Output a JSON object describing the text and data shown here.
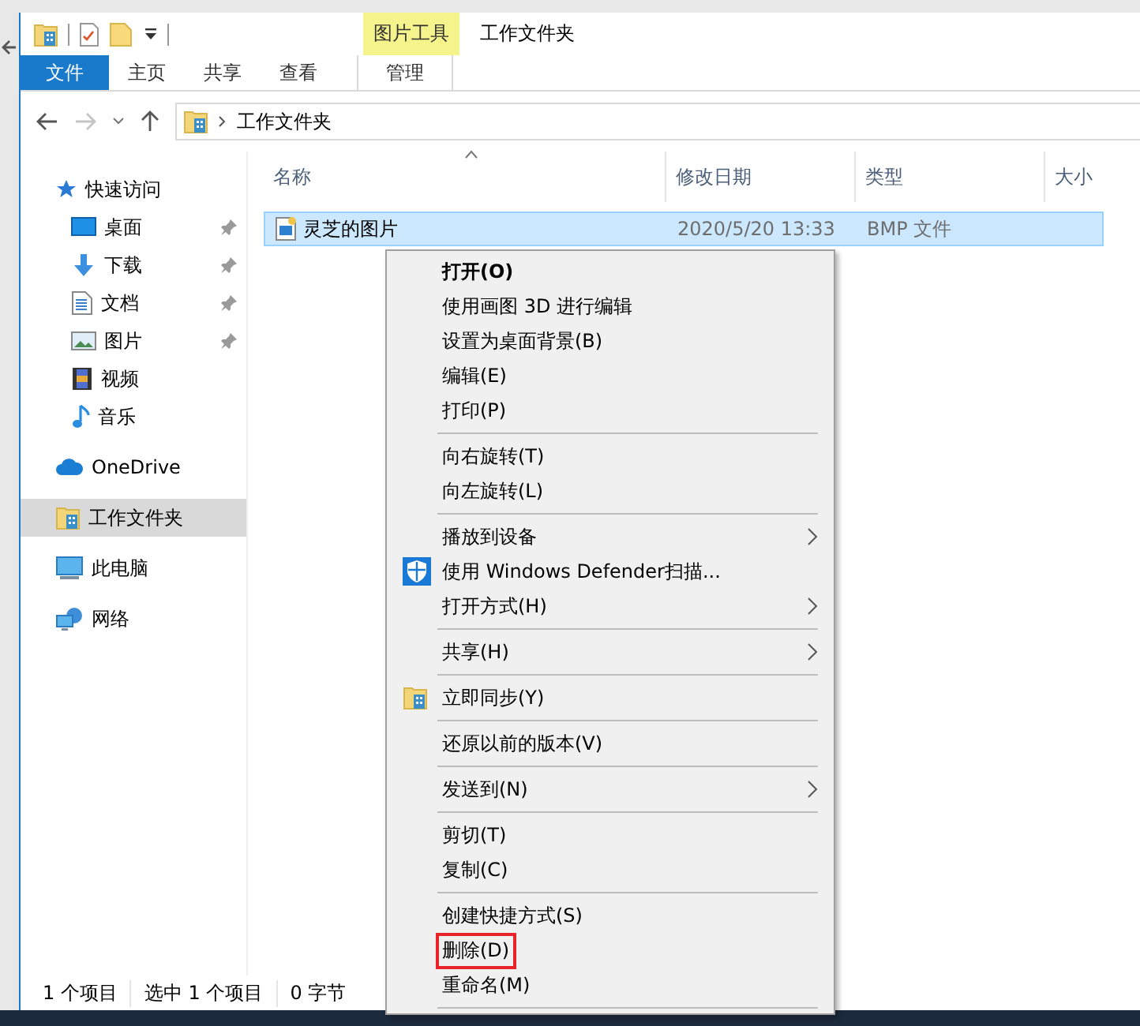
{
  "window": {
    "title": "工作文件夹",
    "contextual_tab": "图片工具"
  },
  "ribbon_tabs": [
    {
      "label": "文件",
      "kind": "file",
      "selected": false
    },
    {
      "label": "主页",
      "kind": "normal",
      "selected": false
    },
    {
      "label": "共享",
      "kind": "normal",
      "selected": false
    },
    {
      "label": "查看",
      "kind": "normal",
      "selected": false
    },
    {
      "label": "管理",
      "kind": "contextual",
      "selected": false
    }
  ],
  "navigation": {
    "back_disabled": false,
    "forward_disabled": true
  },
  "address": {
    "location": "工作文件夹"
  },
  "navigation_pane": [
    {
      "label": "快速访问",
      "selected": false,
      "children": [
        {
          "label": "桌面",
          "pinned": true,
          "selected": false
        },
        {
          "label": "下载",
          "pinned": true,
          "selected": false
        },
        {
          "label": "文档",
          "pinned": true,
          "selected": false
        },
        {
          "label": "图片",
          "pinned": true,
          "selected": false
        },
        {
          "label": "视频",
          "pinned": false,
          "selected": false
        },
        {
          "label": "音乐",
          "pinned": false,
          "selected": false
        }
      ]
    },
    {
      "label": "OneDrive",
      "selected": false
    },
    {
      "label": "工作文件夹",
      "selected": true
    },
    {
      "label": "此电脑",
      "selected": false
    },
    {
      "label": "网络",
      "selected": false
    }
  ],
  "table": {
    "columns": [
      {
        "label": "名称",
        "sorted": true
      },
      {
        "label": "修改日期",
        "sorted": false
      },
      {
        "label": "类型",
        "sorted": false
      },
      {
        "label": "大小",
        "sorted": false
      }
    ],
    "rows": [
      {
        "name": "灵芝的图片",
        "modified": "2020/5/20 13:33",
        "type": "BMP 文件",
        "selected": true
      }
    ]
  },
  "context_menu": [
    {
      "kind": "text",
      "label": "打开(O)",
      "default": true,
      "submenu": false,
      "highlighted": false
    },
    {
      "kind": "text",
      "label": "使用画图 3D 进行编辑",
      "default": false,
      "submenu": false,
      "highlighted": false
    },
    {
      "kind": "text",
      "label": "设置为桌面背景(B)",
      "default": false,
      "submenu": false,
      "highlighted": false
    },
    {
      "kind": "text",
      "label": "编辑(E)",
      "default": false,
      "submenu": false,
      "highlighted": false
    },
    {
      "kind": "text",
      "label": "打印(P)",
      "default": false,
      "submenu": false,
      "highlighted": false
    },
    {
      "kind": "separator"
    },
    {
      "kind": "text",
      "label": "向右旋转(T)",
      "default": false,
      "submenu": false,
      "highlighted": false
    },
    {
      "kind": "text",
      "label": "向左旋转(L)",
      "default": false,
      "submenu": false,
      "highlighted": false
    },
    {
      "kind": "separator"
    },
    {
      "kind": "text",
      "label": "播放到设备",
      "default": false,
      "submenu": true,
      "highlighted": false
    },
    {
      "kind": "shield",
      "label": "使用 Windows Defender扫描...",
      "default": false,
      "submenu": false,
      "highlighted": false
    },
    {
      "kind": "text",
      "label": "打开方式(H)",
      "default": false,
      "submenu": true,
      "highlighted": false
    },
    {
      "kind": "separator"
    },
    {
      "kind": "text",
      "label": "共享(H)",
      "default": false,
      "submenu": true,
      "highlighted": false
    },
    {
      "kind": "separator"
    },
    {
      "kind": "folder",
      "label": "立即同步(Y)",
      "default": false,
      "submenu": false,
      "highlighted": false
    },
    {
      "kind": "separator"
    },
    {
      "kind": "text",
      "label": "还原以前的版本(V)",
      "default": false,
      "submenu": false,
      "highlighted": false
    },
    {
      "kind": "separator"
    },
    {
      "kind": "text",
      "label": "发送到(N)",
      "default": false,
      "submenu": true,
      "highlighted": false
    },
    {
      "kind": "separator"
    },
    {
      "kind": "text",
      "label": "剪切(T)",
      "default": false,
      "submenu": false,
      "highlighted": false
    },
    {
      "kind": "text",
      "label": "复制(C)",
      "default": false,
      "submenu": false,
      "highlighted": false
    },
    {
      "kind": "separator"
    },
    {
      "kind": "text",
      "label": "创建快捷方式(S)",
      "default": false,
      "submenu": false,
      "highlighted": false
    },
    {
      "kind": "text",
      "label": "删除(D)",
      "default": false,
      "submenu": false,
      "highlighted": true
    },
    {
      "kind": "text",
      "label": "重命名(M)",
      "default": false,
      "submenu": false,
      "highlighted": false
    },
    {
      "kind": "separator"
    }
  ],
  "status_bar": [
    "1 个项目",
    "选中 1 个项目",
    "0 字节"
  ]
}
